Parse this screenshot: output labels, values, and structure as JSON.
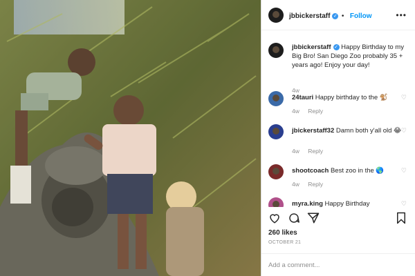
{
  "post": {
    "username": "jbbickerstaff",
    "follow_label": "Follow",
    "caption_user": "jbbickerstaff",
    "caption_text": "Happy Birthday to my Big Bro! San Diego Zoo probably 35 + years ago! Enjoy your day!",
    "caption_age": "4w"
  },
  "comments": [
    {
      "user": "24tauri",
      "text": "Happy birthday to the 🐒",
      "age": "4w",
      "reply": "Reply"
    },
    {
      "user": "jbickerstaff32",
      "text": "Damn both y'all old 😂",
      "age": "4w",
      "reply": "Reply"
    },
    {
      "user": "shootcoach",
      "text": "Best zoo in the 🌎",
      "age": "4w",
      "reply": "Reply"
    },
    {
      "user": "myra.king",
      "text": "Happy Birthday"
    }
  ],
  "likes": "260 likes",
  "date": "OCTOBER 21",
  "add_comment_placeholder": "Add a comment...",
  "colors": {
    "follow_blue": "#0095f6",
    "verified_blue": "#3897f0",
    "muted": "#8e8e8e"
  },
  "icons": [
    "heart-icon",
    "comment-icon",
    "share-icon",
    "bookmark-icon",
    "more-icon",
    "verified-icon"
  ]
}
